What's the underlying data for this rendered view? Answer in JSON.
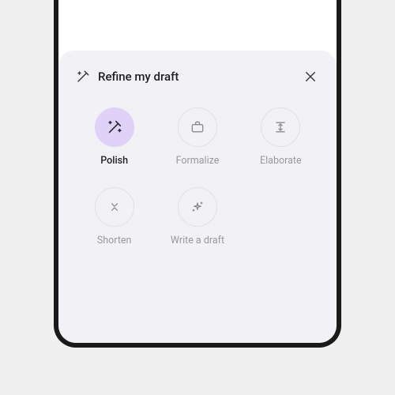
{
  "sheet": {
    "title": "Refine my draft",
    "options": {
      "polish": {
        "label": "Polish",
        "active": true
      },
      "formalize": {
        "label": "Formalize",
        "active": false
      },
      "elaborate": {
        "label": "Elaborate",
        "active": false
      },
      "shorten": {
        "label": "Shorten",
        "active": false
      },
      "write": {
        "label": "Write a draft",
        "active": false
      }
    }
  }
}
